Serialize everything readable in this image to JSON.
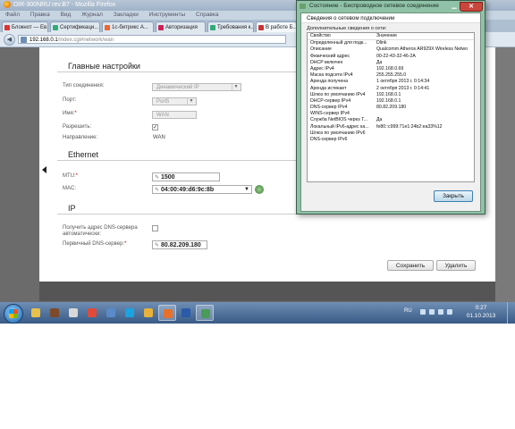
{
  "browser": {
    "window_title": "DIR-300NRU rev.B7 - Mozilla Firefox",
    "menu": [
      "Файл",
      "Правка",
      "Вид",
      "Журнал",
      "Закладки",
      "Инструменты",
      "Справка"
    ],
    "tabs": [
      {
        "label": "Блокнот — Ев...",
        "color": "#d33"
      },
      {
        "label": "Сертификаци...",
        "color": "#3a7"
      },
      {
        "label": "1с-битрикс А...",
        "color": "#e63"
      },
      {
        "label": "Авторизация",
        "color": "#c25"
      },
      {
        "label": "Требования к...",
        "color": "#3a7"
      },
      {
        "label": "В работе Б...",
        "color": "#c33"
      }
    ],
    "url_host": "192.168.0.1",
    "url_path": "/index.cgi#network/wan"
  },
  "router": {
    "main_settings_title": "Главные настройки",
    "fields": {
      "conn_type_label": "Тип соединения:",
      "conn_type_value": "Динамический IP",
      "port_label": "Порт:",
      "port_value": "Port5",
      "name_label": "Имя:",
      "name_value": "WAN",
      "enable_label": "Разрешить:",
      "direction_label": "Направление:",
      "direction_value": "WAN"
    },
    "ethernet_title": "Ethernet",
    "mtu_label": "MTU:",
    "mtu_value": "1500",
    "mac_label": "MAC:",
    "mac_value": "04:00:49:d6:9c:8b",
    "ip_title": "IP",
    "auto_dns_label_1": "Получить адрес DNS-сервера",
    "auto_dns_label_2": "автоматически:",
    "primary_dns_label": "Первичный DNS-сервер:",
    "primary_dns_value": "80.82.209.180",
    "save_label": "Сохранить",
    "delete_label": "Удалить"
  },
  "dialog": {
    "title": "Состояние - Беспроводное сетевое соединение",
    "header": "Сведения о сетевом подключении",
    "group_label": "Дополнительные сведения о сети:",
    "col_property": "Свойство",
    "col_value": "Значение",
    "rows": [
      [
        "Определенный для подк...",
        "Dlink"
      ],
      [
        "Описание",
        "Qualcomm Atheros AR929X Wireless Netwo"
      ],
      [
        "Физический адрес",
        "00-22-43-32-46-2A"
      ],
      [
        "DHCP включен",
        "Да"
      ],
      [
        "Адрес IPv4",
        "192.168.0.69"
      ],
      [
        "Маска подсети IPv4",
        "255.255.255.0"
      ],
      [
        "Аренда получена",
        "1 октября 2013 г. 0:14:34"
      ],
      [
        "Аренда истекает",
        "2 октября 2013 г. 0:14:41"
      ],
      [
        "Шлюз по умолчанию IPv4",
        "192.168.0.1"
      ],
      [
        "DHCP-сервер IPv4",
        "192.168.0.1"
      ],
      [
        "DNS-сервер IPv4",
        "80.82.209.180"
      ],
      [
        "WINS-сервер IPv4",
        ""
      ],
      [
        "Служба NetBIOS через Т...",
        "Да"
      ],
      [
        "Локальный IPv6-адрес ка...",
        "fe80::c999:71e1:24b2:ea33%12"
      ],
      [
        "Шлюз по умолчанию IPv6",
        ""
      ],
      [
        "DNS-сервер IPv6",
        ""
      ]
    ],
    "close_label": "Закрыть"
  },
  "taskbar": {
    "apps": [
      {
        "name": "explorer",
        "color": "#e8c14a"
      },
      {
        "name": "media",
        "color": "#7d4a2a"
      },
      {
        "name": "calendar",
        "color": "#d8d8d8"
      },
      {
        "name": "chrome",
        "color": "#e04a3a"
      },
      {
        "name": "network",
        "color": "#5a8ac8"
      },
      {
        "name": "skype",
        "color": "#1aa3e0"
      },
      {
        "name": "paint",
        "color": "#e8b23a"
      },
      {
        "name": "firefox",
        "color": "#e8702a"
      },
      {
        "name": "word",
        "color": "#2a5aa8"
      },
      {
        "name": "network-status",
        "color": "#4a9a5a"
      }
    ],
    "lang": "RU",
    "time": "0:27",
    "date": "01.10.2013"
  }
}
